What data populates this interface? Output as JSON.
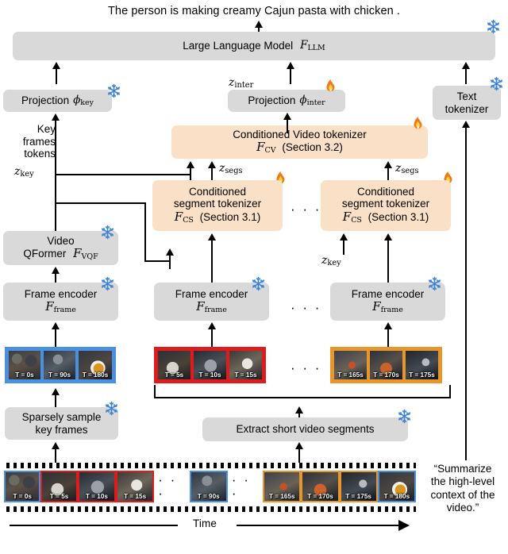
{
  "figure": {
    "output_caption": "The person is making creamy Cajun pasta with chicken .",
    "time_axis_label": "Time",
    "ellipsis": "· · ·"
  },
  "colors": {
    "gray_box": "#d9d9d9",
    "orange_box": "#fbe0c8",
    "key_frame_border": "#4a90e2",
    "segment1_border": "#e01b1b",
    "segment2_border": "#e8962c",
    "snowflake": "#3b82d6",
    "flame": "#ef7a22"
  },
  "blocks": {
    "llm": {
      "label": "Large Language Model",
      "symbol": "F",
      "symbol_sub": "LLM",
      "state": "frozen"
    },
    "projection_key": {
      "label": "Projection",
      "symbol": "ϕ",
      "symbol_sub": "key",
      "state": "frozen"
    },
    "projection_inter": {
      "label": "Projection",
      "symbol": "ϕ",
      "symbol_sub": "inter",
      "state": "trainable"
    },
    "text_tokenizer": {
      "line1": "Text",
      "line2": "tokenizer",
      "state": "frozen"
    },
    "conditioned_video_tokenizer": {
      "line1": "Conditioned Video tokenizer",
      "symbol": "F",
      "symbol_sub": "CV",
      "section": "(Section 3.2)",
      "state": "trainable"
    },
    "conditioned_segment_tokenizer_1": {
      "line1": "Conditioned",
      "line2": "segment tokenizer",
      "symbol": "F",
      "symbol_sub": "CS",
      "section": "(Section 3.1)",
      "state": "trainable"
    },
    "conditioned_segment_tokenizer_2": {
      "line1": "Conditioned",
      "line2": "segment tokenizer",
      "symbol": "F",
      "symbol_sub": "CS",
      "section": "(Section 3.1)",
      "state": "trainable"
    },
    "video_qformer": {
      "line1": "Video",
      "line2": "QFormer",
      "symbol": "F",
      "symbol_sub": "VQF",
      "state": "frozen"
    },
    "frame_encoder_1": {
      "line1": "Frame encoder",
      "symbol": "F",
      "symbol_sub": "frame",
      "state": "frozen"
    },
    "frame_encoder_2": {
      "line1": "Frame encoder",
      "symbol": "F",
      "symbol_sub": "frame",
      "state": "frozen"
    },
    "frame_encoder_3": {
      "line1": "Frame encoder",
      "symbol": "F",
      "symbol_sub": "frame",
      "state": "frozen"
    },
    "sparsely_sample": {
      "line1": "Sparsely sample",
      "line2": "key frames",
      "state": "frozen"
    },
    "extract_segments": {
      "line1": "Extract short video segments",
      "state": "frozen"
    }
  },
  "signal_labels": {
    "key_tokens_l1": "Key",
    "key_tokens_l2": "frames",
    "key_tokens_l3": "tokens",
    "z_key": "z",
    "z_key_sub": "key",
    "z_inter": "z",
    "z_inter_sub": "inter",
    "z_segs": "z",
    "z_segs_sub": "segs",
    "z_key_right": "z",
    "z_key_right_sub": "key"
  },
  "prompt": {
    "line1": "“Summarize",
    "line2": "the high-level",
    "line3": "context of the",
    "line4": "video.”"
  },
  "keyframe_strip": {
    "border_color": "#4a90e2",
    "frames": [
      {
        "time": "T = 0s",
        "img": "k0"
      },
      {
        "time": "T = 90s",
        "img": "k90"
      },
      {
        "time": "T = 180s",
        "img": "k180"
      }
    ]
  },
  "segment_strip_1": {
    "border_color": "#e01b1b",
    "frames": [
      {
        "time": "T = 5s",
        "img": "s5"
      },
      {
        "time": "T = 10s",
        "img": "s10"
      },
      {
        "time": "T = 15s",
        "img": "s15"
      }
    ]
  },
  "segment_strip_2": {
    "border_color": "#e8962c",
    "frames": [
      {
        "time": "T = 165s",
        "img": "s165"
      },
      {
        "time": "T = 170s",
        "img": "s170"
      },
      {
        "time": "T = 175s",
        "img": "s175"
      }
    ]
  },
  "timeline": {
    "frames": [
      {
        "time": "T = 0s",
        "img": "k0",
        "color": "#4a90e2"
      },
      {
        "time": "T = 5s",
        "img": "s5",
        "color": "#e01b1b"
      },
      {
        "time": "T = 10s",
        "img": "s10",
        "color": "#e01b1b"
      },
      {
        "time": "T = 15s",
        "img": "s15",
        "color": "#e01b1b"
      },
      {
        "time": "T = 90s",
        "img": "k90",
        "color": "#4a90e2"
      },
      {
        "time": "T = 165s",
        "img": "s165",
        "color": "#e8962c"
      },
      {
        "time": "T = 170s",
        "img": "s170",
        "color": "#e8962c"
      },
      {
        "time": "T = 175s",
        "img": "s175",
        "color": "#e8962c"
      },
      {
        "time": "T = 180s",
        "img": "k180",
        "color": "#4a90e2"
      }
    ]
  }
}
